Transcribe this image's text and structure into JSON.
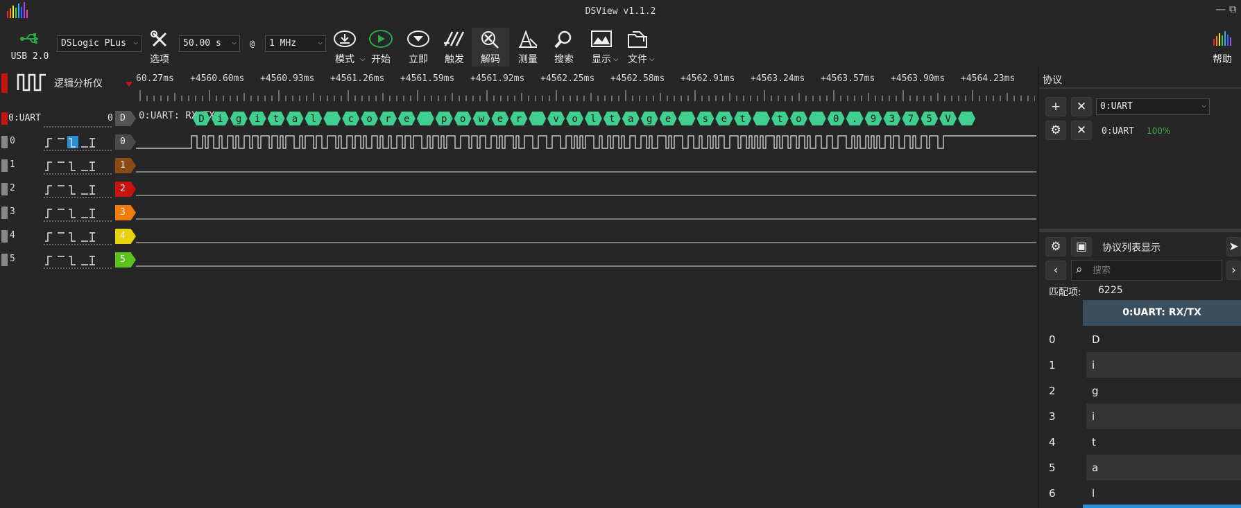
{
  "window": {
    "title": "DSView v1.1.2",
    "controls": [
      "—",
      "⧉"
    ]
  },
  "toolbar": {
    "usb_label": "USB 2.0",
    "device": "DSLogic PLus",
    "duration": "50.00 s",
    "at": "@",
    "rate": "1 MHz",
    "options": "选项",
    "mode": "模式",
    "start": "开始",
    "instant": "立即",
    "trigger": "触发",
    "decode": "解码",
    "measure": "测量",
    "search": "搜索",
    "display": "显示",
    "file": "文件",
    "help": "帮助"
  },
  "waveform": {
    "mode_label": "逻辑分析仪",
    "ruler_ticks": [
      "60.27ms",
      "+4560.60ms",
      "+4560.93ms",
      "+4561.26ms",
      "+4561.59ms",
      "+4561.92ms",
      "+4562.25ms",
      "+4562.58ms",
      "+4562.91ms",
      "+4563.24ms",
      "+4563.57ms",
      "+4563.90ms",
      "+4564.23ms"
    ],
    "decoder_row": {
      "name": "0:UART",
      "index": "0",
      "tag": "D",
      "annotation_label": "0:UART: RX/TX",
      "chars": [
        "D",
        "i",
        "g",
        "i",
        "t",
        "a",
        "l",
        "",
        "c",
        "o",
        "r",
        "e",
        "",
        "p",
        "o",
        "w",
        "e",
        "r",
        "",
        "v",
        "o",
        "l",
        "t",
        "a",
        "g",
        "e",
        "",
        "s",
        "e",
        "t",
        "",
        "t",
        "o",
        "",
        "0",
        ".",
        "9",
        "3",
        "7",
        "5",
        "V",
        ""
      ]
    },
    "channels": [
      {
        "num": "0",
        "tag": "0",
        "color": "#4a4a4a"
      },
      {
        "num": "1",
        "tag": "1",
        "color": "#8a4a12"
      },
      {
        "num": "2",
        "tag": "2",
        "color": "#c8140f"
      },
      {
        "num": "3",
        "tag": "3",
        "color": "#f07a0a"
      },
      {
        "num": "4",
        "tag": "4",
        "color": "#e8d20a"
      },
      {
        "num": "5",
        "tag": "5",
        "color": "#5ec21e"
      }
    ]
  },
  "side": {
    "title": "协议",
    "protocol_select": "0:UART",
    "decoder_name": "0:UART",
    "decoder_progress": "100%",
    "list_title": "协议列表显示",
    "search_placeholder": "搜索",
    "match_label": "匹配项:",
    "match_count": "6225",
    "table_header": "0:UART: RX/TX",
    "rows": [
      {
        "idx": "0",
        "val": "D"
      },
      {
        "idx": "1",
        "val": "i"
      },
      {
        "idx": "2",
        "val": "g"
      },
      {
        "idx": "3",
        "val": "i"
      },
      {
        "idx": "4",
        "val": "t"
      },
      {
        "idx": "5",
        "val": "a"
      },
      {
        "idx": "6",
        "val": "l"
      }
    ]
  },
  "colors": {
    "accent": "#2b8fd6",
    "decode_green": "#3fcf8e",
    "start_green": "#2aa84a",
    "header_bg": "#3b4e5e"
  }
}
